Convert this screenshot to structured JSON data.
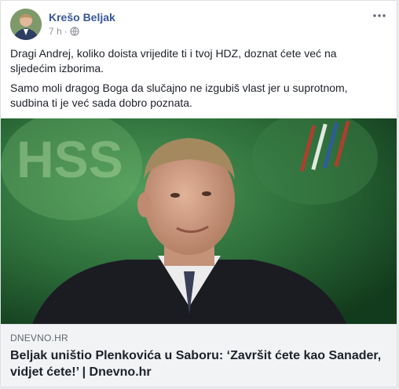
{
  "post": {
    "author": "Krešo Beljak",
    "time": "7 h",
    "separator": "·",
    "paragraphs": [
      "Dragi Andrej, koliko doista vrijedite ti i tvoj HDZ, doznat ćete već na sljedećim izborima.",
      "Samo moli dragog Boga da slučajno ne izgubiš vlast jer u suprotnom, sudbina ti je već sada dobro poznata."
    ]
  },
  "link": {
    "domain": "DNEVNO.HR",
    "title": "Beljak uništio Plenkovića u Saboru: ‘Završit ćete kao Sanader, vidjet ćete!’ | Dnevno.hr",
    "image_text": "HSS"
  },
  "icons": {
    "privacy": "globe-icon",
    "menu": "more-options-icon"
  },
  "colors": {
    "author": "#385898",
    "meta": "#90949c",
    "preview_bg": "#f2f3f5",
    "photo_bg": "#1f5a30"
  }
}
